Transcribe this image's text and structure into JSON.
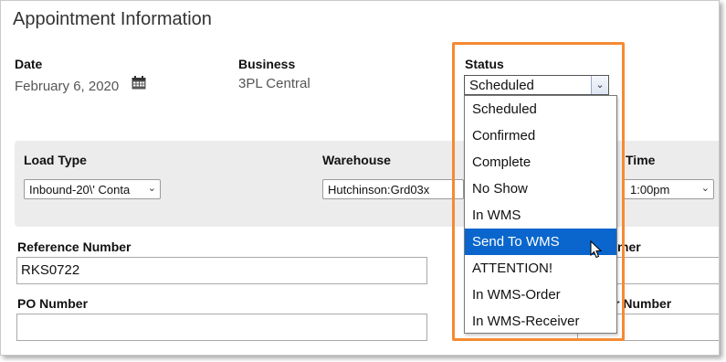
{
  "section_title": "Appointment Information",
  "date": {
    "label": "Date",
    "value": "February 6, 2020"
  },
  "business": {
    "label": "Business",
    "value": "3PL Central"
  },
  "status": {
    "label": "Status",
    "selected": "Scheduled",
    "options": [
      "Scheduled",
      "Confirmed",
      "Complete",
      "No Show",
      "In WMS",
      "Send To WMS",
      "ATTENTION!",
      "In WMS-Order",
      "In WMS-Receiver"
    ],
    "highlighted": "Send To WMS"
  },
  "load_type": {
    "label": "Load Type",
    "value": "Inbound-20\\' Conta"
  },
  "warehouse": {
    "label": "Warehouse",
    "value": "Hutchinson:Grd03x"
  },
  "time": {
    "label": "Time",
    "value": "1:00pm"
  },
  "reference_number": {
    "label": "Reference Number",
    "value": "RKS0722"
  },
  "po_number": {
    "label": "PO Number",
    "value": ""
  },
  "partial_labels": {
    "customer_suffix": "mer",
    "number_suffix": "r Number"
  },
  "colors": {
    "highlight": "#0a66cc",
    "callout_border": "#f58a32",
    "panel_bg": "#ececec"
  }
}
